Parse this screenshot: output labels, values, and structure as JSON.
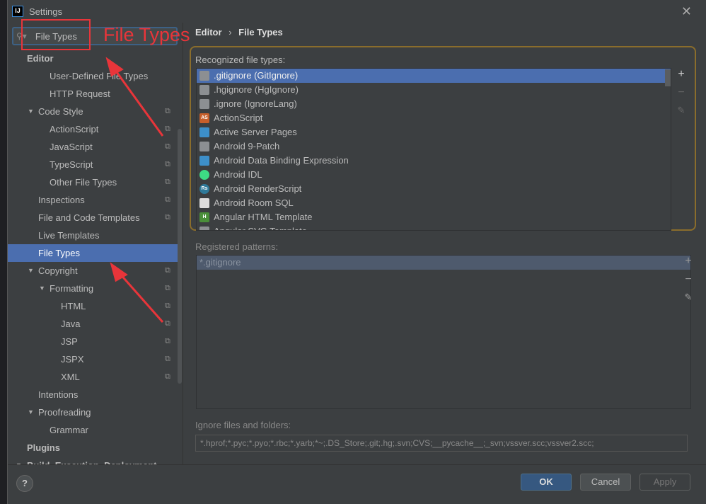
{
  "window": {
    "title": "Settings",
    "logo": "IJ",
    "close_icon": "close-icon"
  },
  "search": {
    "value": "File Types"
  },
  "tree": [
    {
      "label": "Editor",
      "level": 0,
      "bold": true
    },
    {
      "label": "User-Defined File Types",
      "level": 2
    },
    {
      "label": "HTTP Request",
      "level": 2
    },
    {
      "label": "Code Style",
      "level": 1,
      "expanded": true,
      "copy": true
    },
    {
      "label": "ActionScript",
      "level": 2,
      "copy": true
    },
    {
      "label": "JavaScript",
      "level": 2,
      "copy": true
    },
    {
      "label": "TypeScript",
      "level": 2,
      "copy": true
    },
    {
      "label": "Other File Types",
      "level": 2,
      "copy": true
    },
    {
      "label": "Inspections",
      "level": 1,
      "copy": true
    },
    {
      "label": "File and Code Templates",
      "level": 1,
      "copy": true
    },
    {
      "label": "Live Templates",
      "level": 1
    },
    {
      "label": "File Types",
      "level": 1,
      "selected": true
    },
    {
      "label": "Copyright",
      "level": 1,
      "expanded": true,
      "copy": true
    },
    {
      "label": "Formatting",
      "level": 2,
      "expanded": true,
      "copy": true
    },
    {
      "label": "HTML",
      "level": 3,
      "copy": true
    },
    {
      "label": "Java",
      "level": 3,
      "copy": true
    },
    {
      "label": "JSP",
      "level": 3,
      "copy": true
    },
    {
      "label": "JSPX",
      "level": 3,
      "copy": true
    },
    {
      "label": "XML",
      "level": 3,
      "copy": true
    },
    {
      "label": "Intentions",
      "level": 1
    },
    {
      "label": "Proofreading",
      "level": 1,
      "expanded": true
    },
    {
      "label": "Grammar",
      "level": 2
    },
    {
      "label": "Plugins",
      "level": 0,
      "bold": true
    },
    {
      "label": "Build, Execution, Deployment",
      "level": 0,
      "bold": true,
      "expanded": true
    }
  ],
  "breadcrumb": {
    "parent": "Editor",
    "separator": "›",
    "current": "File Types"
  },
  "recognized": {
    "label": "Recognized file types:",
    "items": [
      {
        "label": ".gitignore (GitIgnore)",
        "icon": "ignore",
        "selected": true
      },
      {
        "label": ".hgignore (HgIgnore)",
        "icon": "ignore"
      },
      {
        "label": ".ignore (IgnoreLang)",
        "icon": "ignore"
      },
      {
        "label": "ActionScript",
        "icon": "AS"
      },
      {
        "label": "Active Server Pages",
        "icon": "person"
      },
      {
        "label": "Android 9-Patch",
        "icon": "folder"
      },
      {
        "label": "Android Data Binding Expression",
        "icon": "person"
      },
      {
        "label": "Android IDL",
        "icon": "android"
      },
      {
        "label": "Android RenderScript",
        "icon": "Rs"
      },
      {
        "label": "Android Room SQL",
        "icon": "table"
      },
      {
        "label": "Angular HTML Template",
        "icon": "H"
      },
      {
        "label": "Angular SVG Template",
        "icon": "file"
      }
    ]
  },
  "patterns": {
    "label": "Registered patterns:",
    "items": [
      "*.gitignore"
    ]
  },
  "ignore": {
    "label": "Ignore files and folders:",
    "value": "*.hprof;*.pyc;*.pyo;*.rbc;*.yarb;*~;.DS_Store;.git;.hg;.svn;CVS;__pycache__;_svn;vssver.scc;vssver2.scc;"
  },
  "tools": {
    "add": "+",
    "remove": "−",
    "edit": "✎"
  },
  "footer": {
    "help": "?",
    "ok": "OK",
    "cancel": "Cancel",
    "apply": "Apply"
  },
  "annotation": {
    "text": "File Types",
    "color": "#e8353a"
  },
  "colors": {
    "selection": "#4b6eaf",
    "panel": "#3c3f41",
    "ok_button": "#365880"
  }
}
